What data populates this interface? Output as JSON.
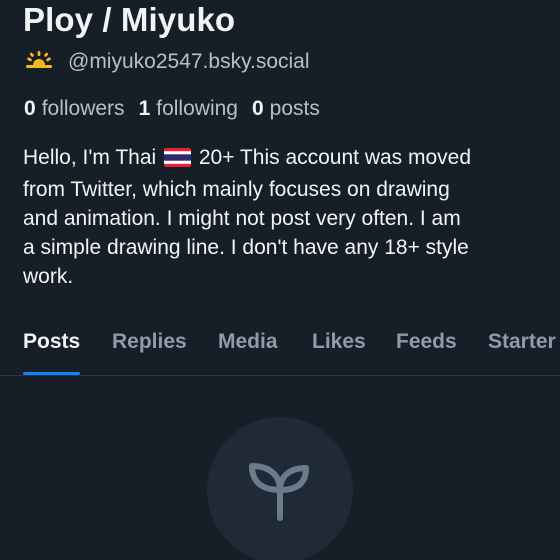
{
  "profile": {
    "display_name": "Ploy / Miyuko",
    "handle_icon": "sunrise-emoji",
    "handle": "@miyuko2547.bsky.social"
  },
  "stats": {
    "followers_count": "0",
    "followers_label": "followers",
    "following_count": "1",
    "following_label": "following",
    "posts_count": "0",
    "posts_label": "posts"
  },
  "bio": {
    "line1_before_flag": "Hello, I'm Thai",
    "flag_icon": "thailand-flag-emoji",
    "line1_after_flag": "20+ This account was moved",
    "line2": "from Twitter, which mainly focuses on drawing",
    "line3": "and animation. I might not post very often. I am",
    "line4": "a simple drawing line. I don't have any 18+ style",
    "line5": "work."
  },
  "tabs": {
    "active": "Posts",
    "items": [
      {
        "label": "Posts"
      },
      {
        "label": "Replies"
      },
      {
        "label": "Media"
      },
      {
        "label": "Likes"
      },
      {
        "label": "Feeds"
      },
      {
        "label": "Starter"
      }
    ]
  },
  "empty_state": {
    "icon": "sprout-icon"
  },
  "colors": {
    "background": "#161e27",
    "primary_text": "#f1f3f5",
    "secondary_text": "#b6c0cc",
    "inactive_tab": "#8e9baa",
    "accent": "#1083fe",
    "divider": "#2b3642",
    "empty_circle": "#1f2a36",
    "sprout": "#6b7b8c"
  }
}
